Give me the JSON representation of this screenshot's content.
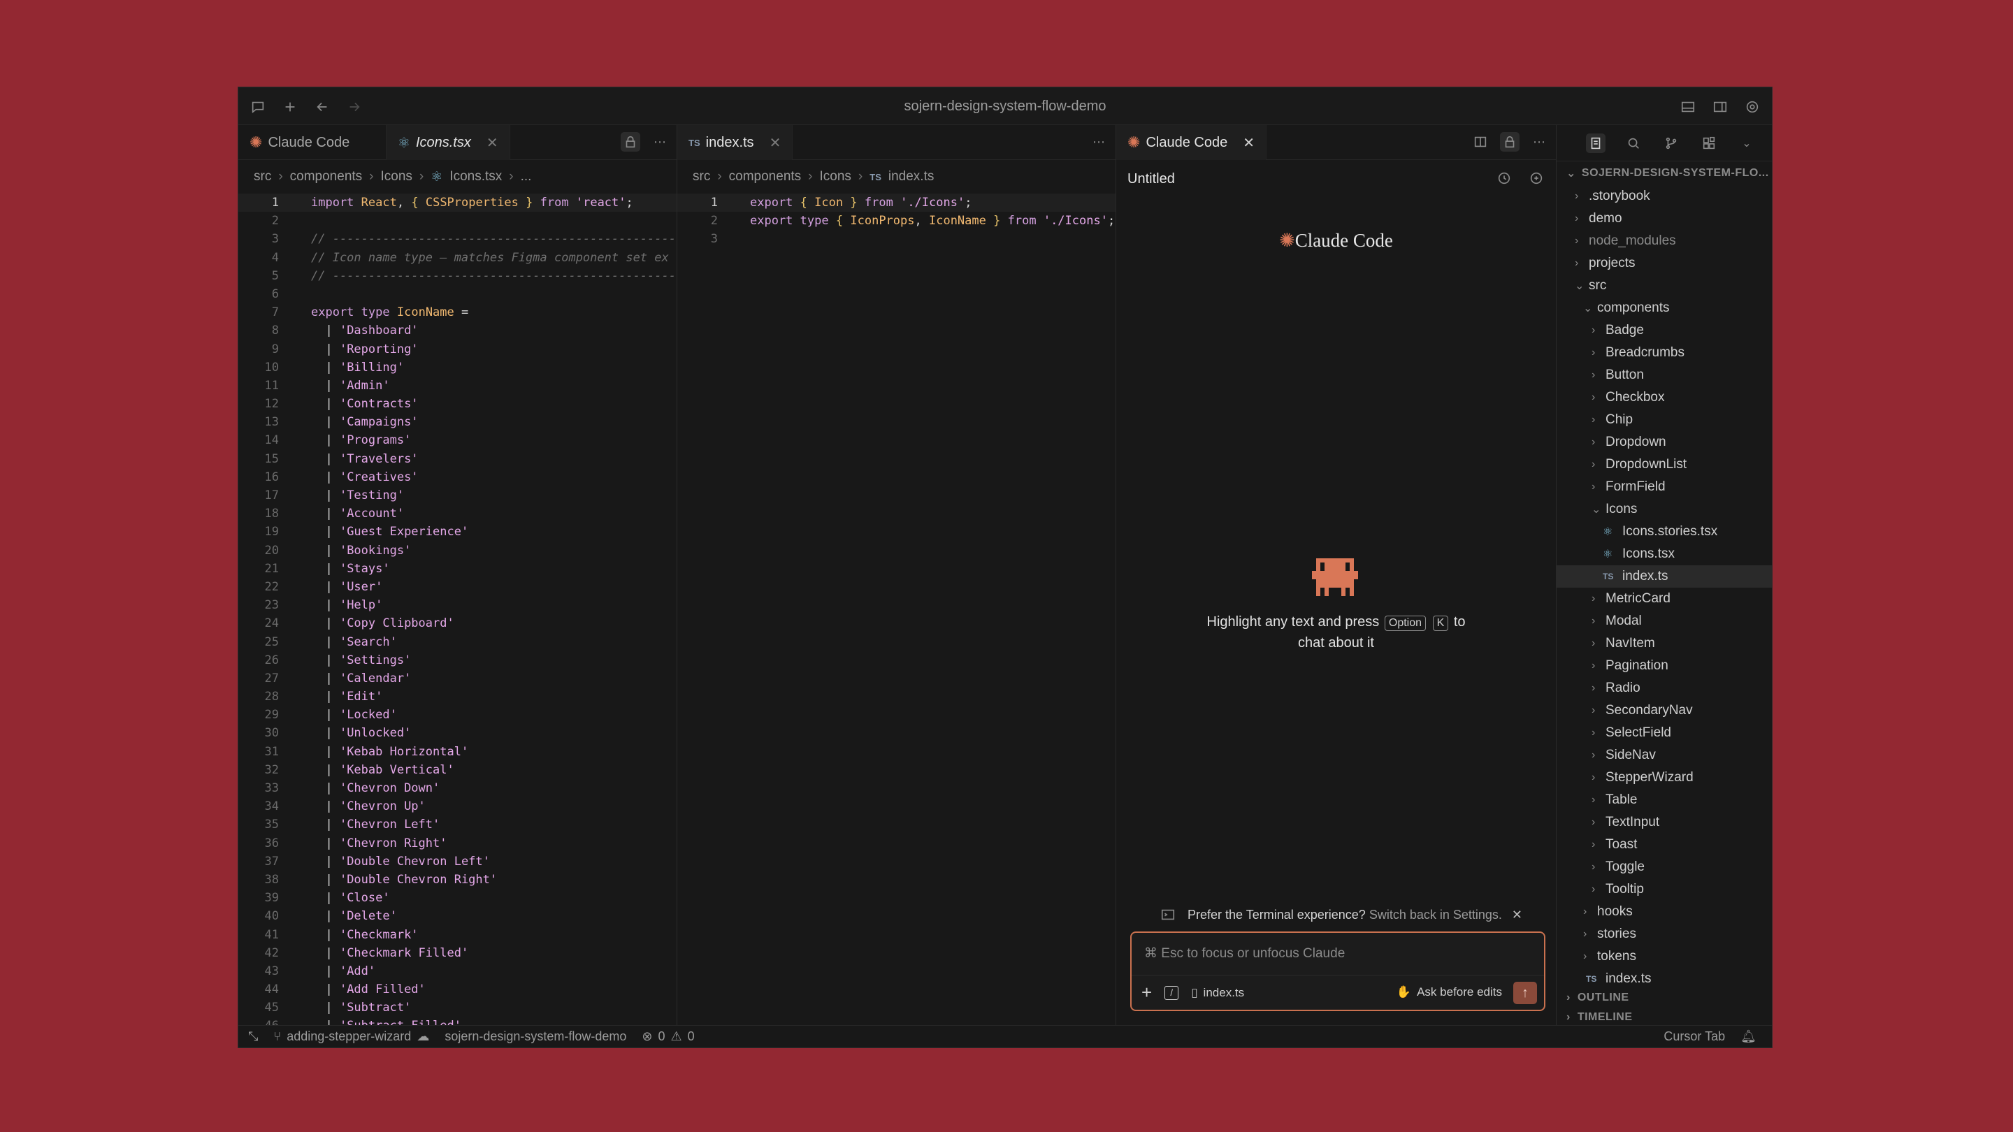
{
  "window": {
    "title": "sojern-design-system-flow-demo"
  },
  "pane1": {
    "tabs": [
      {
        "label": "Claude Code",
        "icon": "claude-star-icon"
      },
      {
        "label": "Icons.tsx",
        "icon": "react-icon"
      }
    ],
    "breadcrumb": [
      "src",
      "components",
      "Icons",
      "Icons.tsx",
      "..."
    ],
    "lines": [
      "import React, { CSSProperties } from 'react';",
      "",
      "// --------------------------------------------------",
      "// Icon name type — matches Figma component set ex",
      "// --------------------------------------------------",
      "",
      "export type IconName =",
      "  | 'Dashboard'",
      "  | 'Reporting'",
      "  | 'Billing'",
      "  | 'Admin'",
      "  | 'Contracts'",
      "  | 'Campaigns'",
      "  | 'Programs'",
      "  | 'Travelers'",
      "  | 'Creatives'",
      "  | 'Testing'",
      "  | 'Account'",
      "  | 'Guest Experience'",
      "  | 'Bookings'",
      "  | 'Stays'",
      "  | 'User'",
      "  | 'Help'",
      "  | 'Copy Clipboard'",
      "  | 'Search'",
      "  | 'Settings'",
      "  | 'Calendar'",
      "  | 'Edit'",
      "  | 'Locked'",
      "  | 'Unlocked'",
      "  | 'Kebab Horizontal'",
      "  | 'Kebab Vertical'",
      "  | 'Chevron Down'",
      "  | 'Chevron Up'",
      "  | 'Chevron Left'",
      "  | 'Chevron Right'",
      "  | 'Double Chevron Left'",
      "  | 'Double Chevron Right'",
      "  | 'Close'",
      "  | 'Delete'",
      "  | 'Checkmark'",
      "  | 'Checkmark Filled'",
      "  | 'Add'",
      "  | 'Add Filled'",
      "  | 'Subtract'",
      "  | 'Subtract Filled'"
    ]
  },
  "pane2": {
    "tab": {
      "label": "index.ts",
      "badge": "TS"
    },
    "breadcrumb": [
      "src",
      "components",
      "Icons",
      "index.ts"
    ],
    "lines": [
      "export { Icon } from './Icons';",
      "export type { IconProps, IconName } from './Icons';",
      ""
    ]
  },
  "pane3": {
    "tab": {
      "label": "Claude Code"
    },
    "untitled": "Untitled",
    "logo": "Claude Code",
    "hint_before": "Highlight any text and press",
    "key1": "Option",
    "key2": "K",
    "hint_mid": "to",
    "hint_after": "chat about it",
    "terminal_note": "Prefer the Terminal experience?",
    "terminal_link": "Switch back in Settings.",
    "input_placeholder": "⌘ Esc to focus or unfocus Claude",
    "file_chip": "index.ts",
    "ask_mode": "Ask before edits"
  },
  "explorer": {
    "root": "SOJERN-DESIGN-SYSTEM-FLO...",
    "items": [
      {
        "label": ".storybook",
        "depth": 0,
        "kind": "folder",
        "open": false
      },
      {
        "label": "demo",
        "depth": 0,
        "kind": "folder",
        "open": false
      },
      {
        "label": "node_modules",
        "depth": 0,
        "kind": "folder",
        "open": false,
        "dim": true
      },
      {
        "label": "projects",
        "depth": 0,
        "kind": "folder",
        "open": false
      },
      {
        "label": "src",
        "depth": 0,
        "kind": "folder",
        "open": true
      },
      {
        "label": "components",
        "depth": 1,
        "kind": "folder",
        "open": true
      },
      {
        "label": "Badge",
        "depth": 2,
        "kind": "folder",
        "open": false
      },
      {
        "label": "Breadcrumbs",
        "depth": 2,
        "kind": "folder",
        "open": false
      },
      {
        "label": "Button",
        "depth": 2,
        "kind": "folder",
        "open": false
      },
      {
        "label": "Checkbox",
        "depth": 2,
        "kind": "folder",
        "open": false
      },
      {
        "label": "Chip",
        "depth": 2,
        "kind": "folder",
        "open": false
      },
      {
        "label": "Dropdown",
        "depth": 2,
        "kind": "folder",
        "open": false
      },
      {
        "label": "DropdownList",
        "depth": 2,
        "kind": "folder",
        "open": false
      },
      {
        "label": "FormField",
        "depth": 2,
        "kind": "folder",
        "open": false
      },
      {
        "label": "Icons",
        "depth": 2,
        "kind": "folder",
        "open": true
      },
      {
        "label": "Icons.stories.tsx",
        "depth": 3,
        "kind": "react"
      },
      {
        "label": "Icons.tsx",
        "depth": 3,
        "kind": "react"
      },
      {
        "label": "index.ts",
        "depth": 3,
        "kind": "ts",
        "selected": true
      },
      {
        "label": "MetricCard",
        "depth": 2,
        "kind": "folder",
        "open": false
      },
      {
        "label": "Modal",
        "depth": 2,
        "kind": "folder",
        "open": false
      },
      {
        "label": "NavItem",
        "depth": 2,
        "kind": "folder",
        "open": false
      },
      {
        "label": "Pagination",
        "depth": 2,
        "kind": "folder",
        "open": false
      },
      {
        "label": "Radio",
        "depth": 2,
        "kind": "folder",
        "open": false
      },
      {
        "label": "SecondaryNav",
        "depth": 2,
        "kind": "folder",
        "open": false
      },
      {
        "label": "SelectField",
        "depth": 2,
        "kind": "folder",
        "open": false
      },
      {
        "label": "SideNav",
        "depth": 2,
        "kind": "folder",
        "open": false
      },
      {
        "label": "StepperWizard",
        "depth": 2,
        "kind": "folder",
        "open": false
      },
      {
        "label": "Table",
        "depth": 2,
        "kind": "folder",
        "open": false
      },
      {
        "label": "TextInput",
        "depth": 2,
        "kind": "folder",
        "open": false
      },
      {
        "label": "Toast",
        "depth": 2,
        "kind": "folder",
        "open": false
      },
      {
        "label": "Toggle",
        "depth": 2,
        "kind": "folder",
        "open": false
      },
      {
        "label": "Tooltip",
        "depth": 2,
        "kind": "folder",
        "open": false
      },
      {
        "label": "hooks",
        "depth": 1,
        "kind": "folder",
        "open": false
      },
      {
        "label": "stories",
        "depth": 1,
        "kind": "folder",
        "open": false
      },
      {
        "label": "tokens",
        "depth": 1,
        "kind": "folder",
        "open": false
      },
      {
        "label": "index.ts",
        "depth": 1,
        "kind": "ts"
      }
    ],
    "outline": "OUTLINE",
    "timeline": "TIMELINE"
  },
  "status": {
    "branch": "adding-stepper-wizard",
    "project": "sojern-design-system-flow-demo",
    "errors": "0",
    "warnings": "0",
    "right": "Cursor Tab"
  }
}
